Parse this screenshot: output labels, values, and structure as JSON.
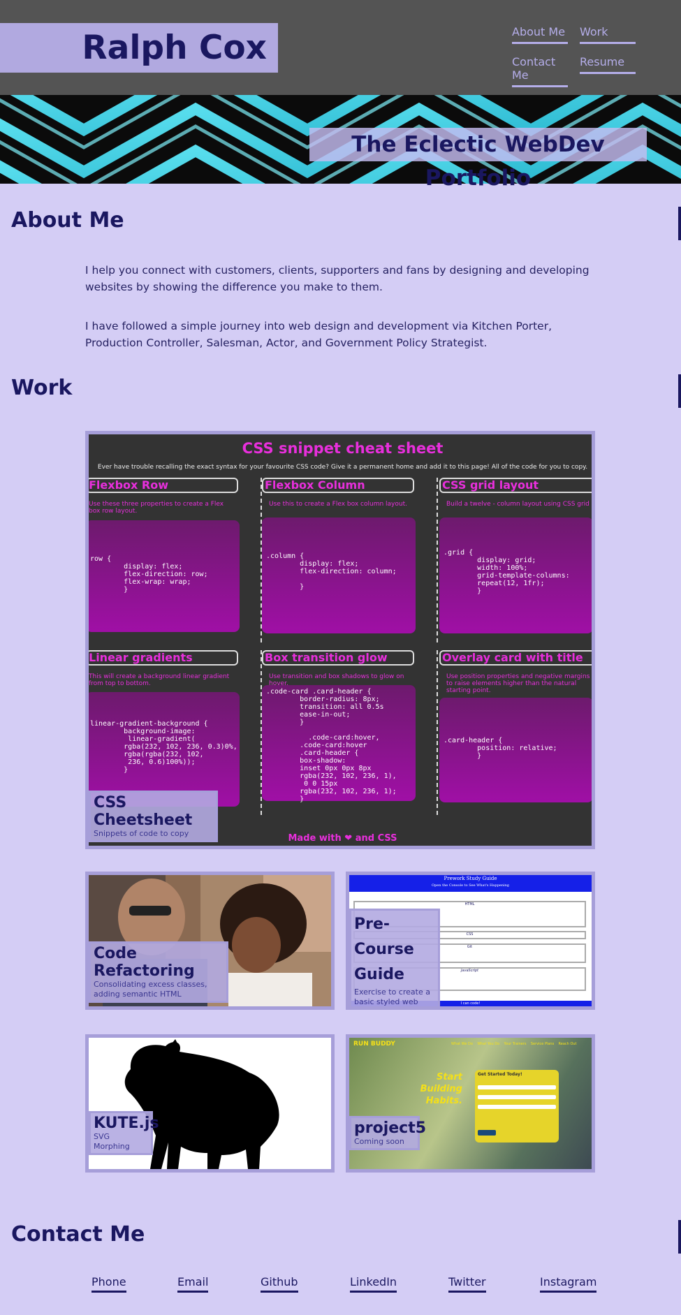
{
  "header": {
    "name": "Ralph Cox",
    "nav": [
      {
        "label": "About Me"
      },
      {
        "label": "Work"
      },
      {
        "label": "Contact Me"
      },
      {
        "label": "Resume"
      }
    ]
  },
  "hero": {
    "title": "The Eclectic WebDev Portfolio"
  },
  "about": {
    "heading": "About Me",
    "paragraphs": [
      "I help you connect with customers, clients, supporters and fans by designing and developing websites by showing the difference you make to them.",
      "I have followed a simple journey into web design and development via Kitchen Porter, Production Controller, Salesman, Actor, and Government Policy Strategist."
    ]
  },
  "work": {
    "heading": "Work",
    "projects": [
      {
        "title": "CSS Cheetsheet",
        "subtitle": "Snippets of code to copy"
      },
      {
        "title": "Code Refactoring",
        "subtitle": "Consolidating excess classes, adding semantic HTML"
      },
      {
        "title": "Pre-Course Guide",
        "subtitle": "Exercise to create a basic styled web page in Repo"
      },
      {
        "title": "KUTE.js",
        "subtitle": "SVG Morphing"
      },
      {
        "title": "project5",
        "subtitle": "Coming soon"
      }
    ],
    "cheatsheet": {
      "title": "CSS snippet cheat sheet",
      "subtitle": "Ever have trouble recalling the exact syntax for your favourite CSS code? Give it a permanent home and add it to this page! All of the code for you to copy.",
      "footer": "Made with ❤ and CSS",
      "boxes": [
        {
          "head": "Flexbox Row",
          "desc": "Use these three properties to create a Flex box row layout.",
          "code": "row {\n        display: flex;\n        flex-direction: row;\n        flex-wrap: wrap;\n        }"
        },
        {
          "head": "Flexbox Column",
          "desc": "Use this to create a Flex box column layout.",
          "code": ".column {\n        display: flex;\n        flex-direction: column;\n\n        }"
        },
        {
          "head": "CSS grid layout",
          "desc": "Build a twelve - column layout using CSS grid",
          "code": ".grid {\n        display: grid;\n        width: 100%;\n        grid-template-columns:\n        repeat(12, 1fr);\n        }"
        },
        {
          "head": "Linear gradients",
          "desc": "This will create a background linear gradient from top to bottom.",
          "code": "linear-gradient-background {\n        background-image:\n         linear-gradient(\n        rgba(232, 102, 236, 0.3)0%,\n        rgba(rgba(232, 102,\n         236, 0.6)100%));\n        }"
        },
        {
          "head": "Box transition glow",
          "desc": "Use transition and box shadows to glow on hover.",
          "code": ".code-card .card-header {\n        border-radius: 8px;\n        transition: all 0.5s\n        ease-in-out;\n        }\n\n          .code-card:hover,\n        .code-card:hover\n        .card-header {\n        box-shadow:\n        inset 0px 0px 8px\n        rgba(232, 102, 236, 1),\n         0 0 15px\n        rgba(232, 102, 236, 1);\n        }"
        },
        {
          "head": "Overlay card with title",
          "desc": "Use position properties and negative margins to raise elements higher than the natural starting point.",
          "code": ".card-header {\n        position: relative;\n        }"
        }
      ]
    },
    "preguide": {
      "banner": "Prework Study Guide",
      "sub": "Open the Console to See What's Happening",
      "sections": [
        "HTML",
        "CSS",
        "Git",
        "JavaScript"
      ],
      "footer": "I can code!"
    },
    "runbuddy": {
      "logo": "RUN BUDDY",
      "nav": [
        "What We Do",
        "What You Do",
        "Your Trainers",
        "Service Plans",
        "Reach Out"
      ],
      "headline": "Start Building Habits.",
      "form_title": "Get Started Today!"
    }
  },
  "contact": {
    "heading": "Contact Me",
    "links": [
      {
        "label": "Phone"
      },
      {
        "label": "Email"
      },
      {
        "label": "Github"
      },
      {
        "label": "LinkedIn"
      },
      {
        "label": "Twitter"
      },
      {
        "label": "Instagram"
      }
    ]
  }
}
